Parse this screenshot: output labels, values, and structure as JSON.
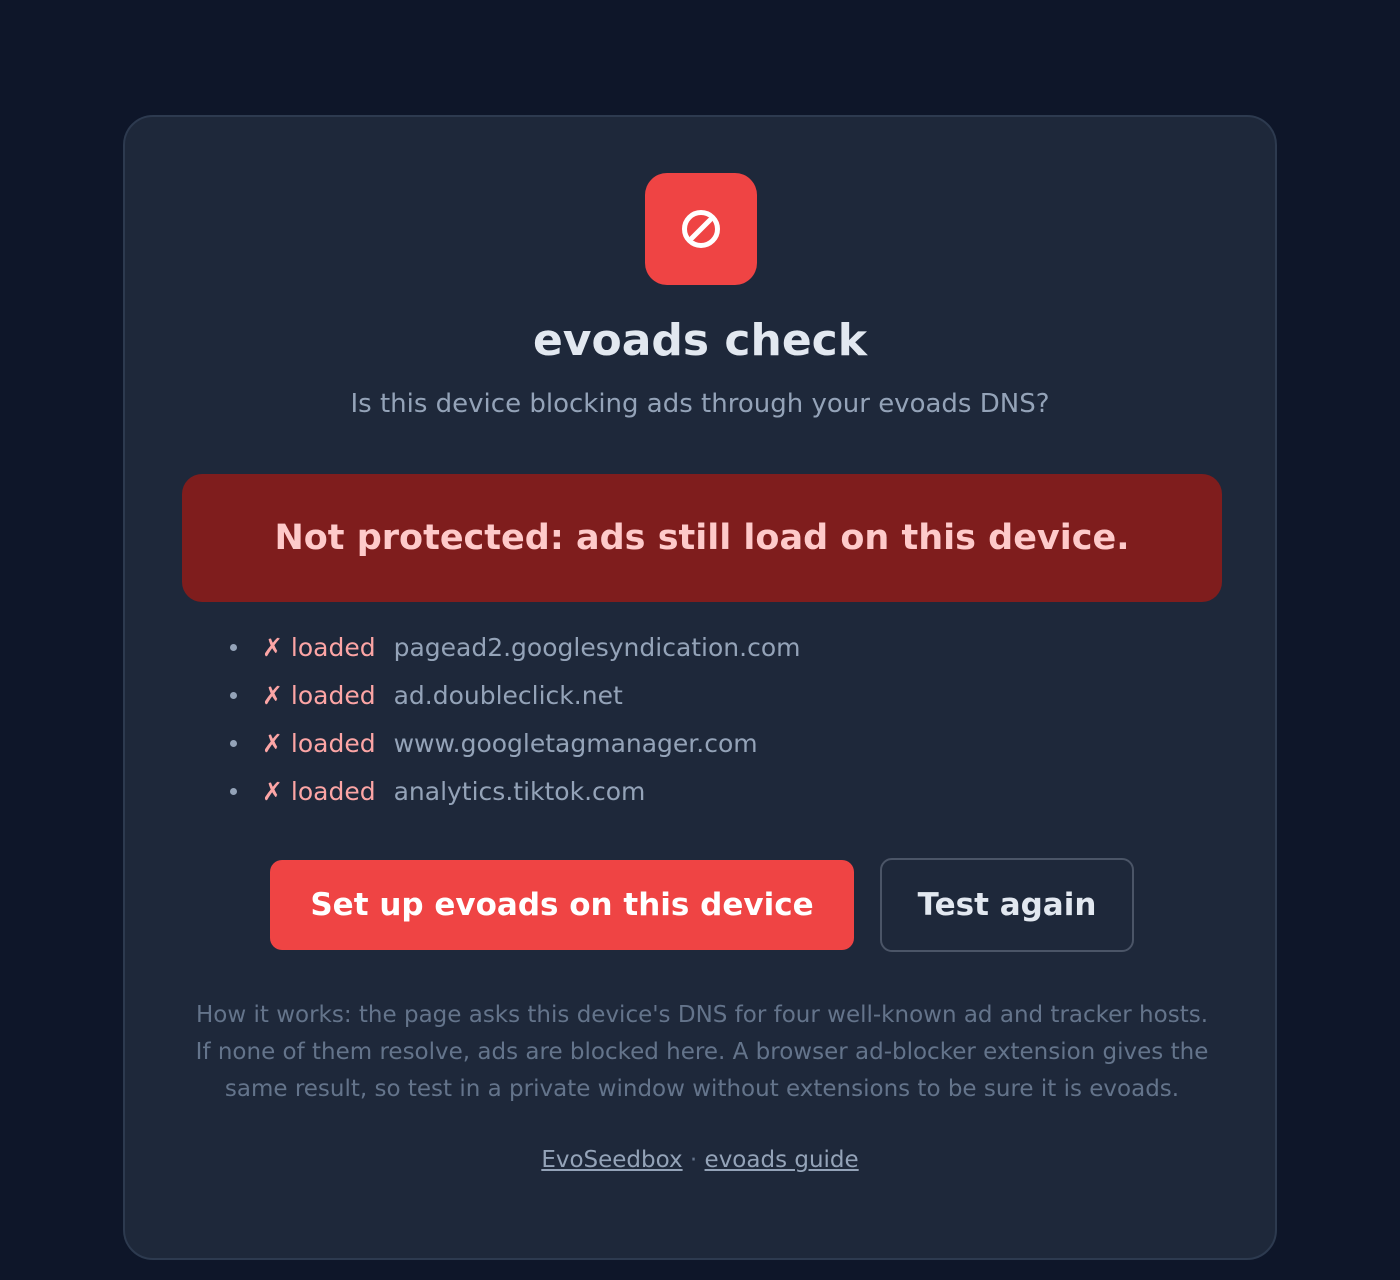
{
  "app": {
    "title": "evoads check",
    "subtitle": "Is this device blocking ads through your evoads DNS?",
    "logo_icon": "no-entry-icon"
  },
  "status_banner": {
    "text": "Not protected: ads still load on this device.",
    "background": "#7f1d1d",
    "color": "#fecaca"
  },
  "checks": [
    {
      "status": "✗ loaded",
      "host": "pagead2.googlesyndication.com"
    },
    {
      "status": "✗ loaded",
      "host": "ad.doubleclick.net"
    },
    {
      "status": "✗ loaded",
      "host": "www.googletagmanager.com"
    },
    {
      "status": "✗ loaded",
      "host": "analytics.tiktok.com"
    }
  ],
  "actions": {
    "setup_label": "Set up evoads on this device",
    "retest_label": "Test again"
  },
  "explanation": "How it works: the page asks this device's DNS for four well-known ad and tracker hosts. If none of them resolve, ads are blocked here. A browser ad-blocker extension gives the same result, so test in a private window without extensions to be sure it is evoads.",
  "footer": {
    "link1": "EvoSeedbox",
    "separator": "·",
    "link2": "evoads guide"
  },
  "colors": {
    "page_background": "#0e1629",
    "card_background": "#1e283a",
    "accent": "#ef4444",
    "failed_status": "#fca5a5"
  }
}
